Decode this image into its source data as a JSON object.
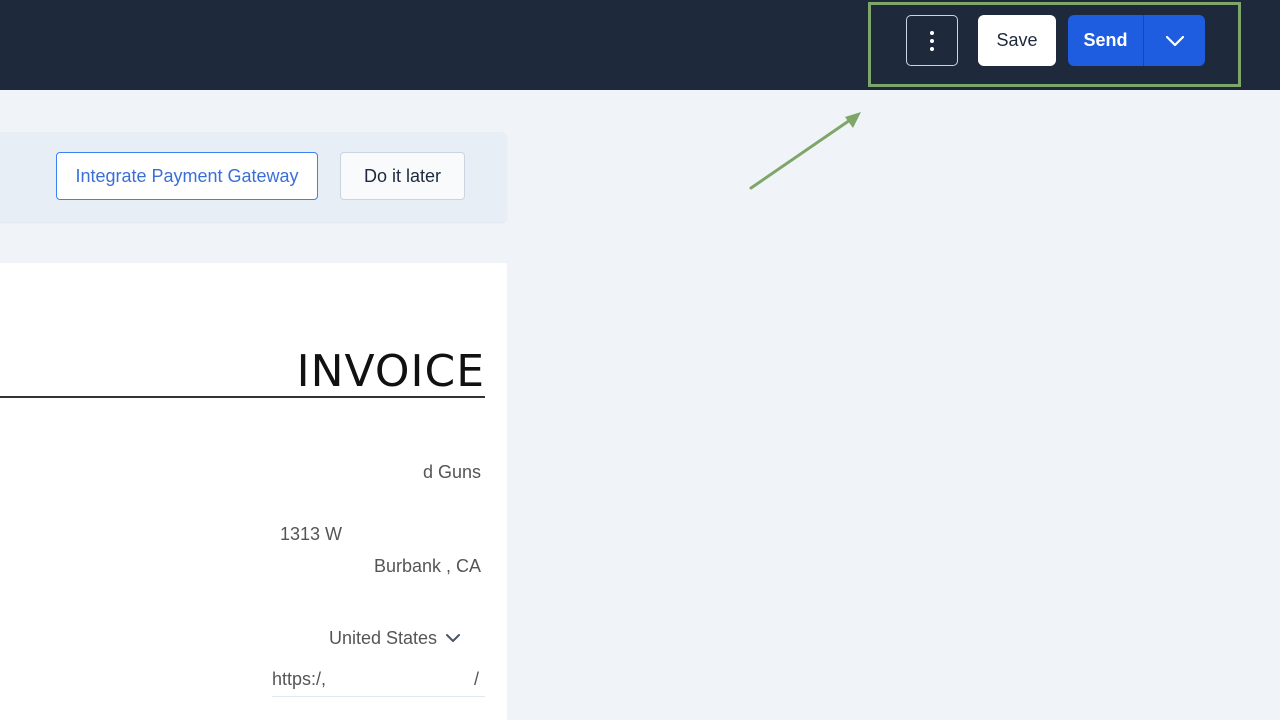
{
  "toolbar": {
    "save_label": "Save",
    "send_label": "Send",
    "more_icon": "vertical-ellipsis-icon",
    "dropdown_icon": "chevron-down-icon"
  },
  "banner": {
    "integrate_label": "Integrate Payment Gateway",
    "later_label": "Do it later"
  },
  "invoice": {
    "title": "INVOICE",
    "company_name": "d Guns",
    "address_line": "1313 W",
    "city_state": "Burbank ,  CA",
    "country": "United States",
    "website_start": "https:/,",
    "website_end": "/"
  },
  "colors": {
    "topbar_bg": "#1e293b",
    "send_blue": "#1f5de0",
    "highlight_green": "#7fa66a",
    "page_bg": "#f0f4f8"
  }
}
